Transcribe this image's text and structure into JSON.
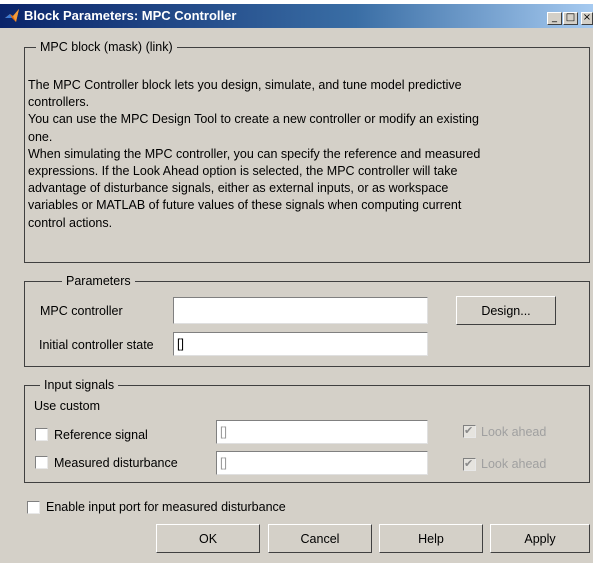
{
  "window": {
    "title": "Block Parameters: MPC Controller",
    "icon": "matlab-icon",
    "controls": {
      "minimize": "_",
      "maximize": "□",
      "close": "×"
    }
  },
  "mask": {
    "group_title": "MPC block (mask) (link)",
    "description": "The MPC Controller block lets you design, simulate, and tune model predictive\ncontrollers.\nYou can use the MPC Design Tool to create a new controller or modify an existing\none.\nWhen simulating the MPC controller, you can specify the reference and measured\nexpressions. If the Look Ahead option is selected, the MPC controller will take\nadvantage of disturbance signals, either as external inputs, or as workspace\nvariables or MATLAB of future values of these signals when computing current\ncontrol actions."
  },
  "parameters": {
    "group_title": "Parameters",
    "mpc_controller_label": "MPC controller",
    "mpc_controller_value": "",
    "design_button": "Design...",
    "initial_state_label": "Initial controller state",
    "initial_state_value": "[]"
  },
  "input_signals": {
    "group_title": "Input signals",
    "use_custom_label": "Use custom",
    "reference": {
      "label": "Reference signal",
      "value": "[]",
      "checked": false,
      "look_ahead_label": "Look ahead",
      "look_ahead_checked": true
    },
    "measured": {
      "label": "Measured disturbance",
      "value": "[]",
      "checked": false,
      "look_ahead_label": "Look ahead",
      "look_ahead_checked": true
    }
  },
  "enable_input_port": {
    "label": "Enable input port for measured disturbance",
    "checked": false
  },
  "buttons": {
    "ok": "OK",
    "cancel": "Cancel",
    "help": "Help",
    "apply": "Apply"
  },
  "colors": {
    "dialog_bg": "#d4d0c8",
    "title_start": "#0a246a",
    "title_end": "#a6caf0",
    "matlab_orange": "#e06a10"
  }
}
